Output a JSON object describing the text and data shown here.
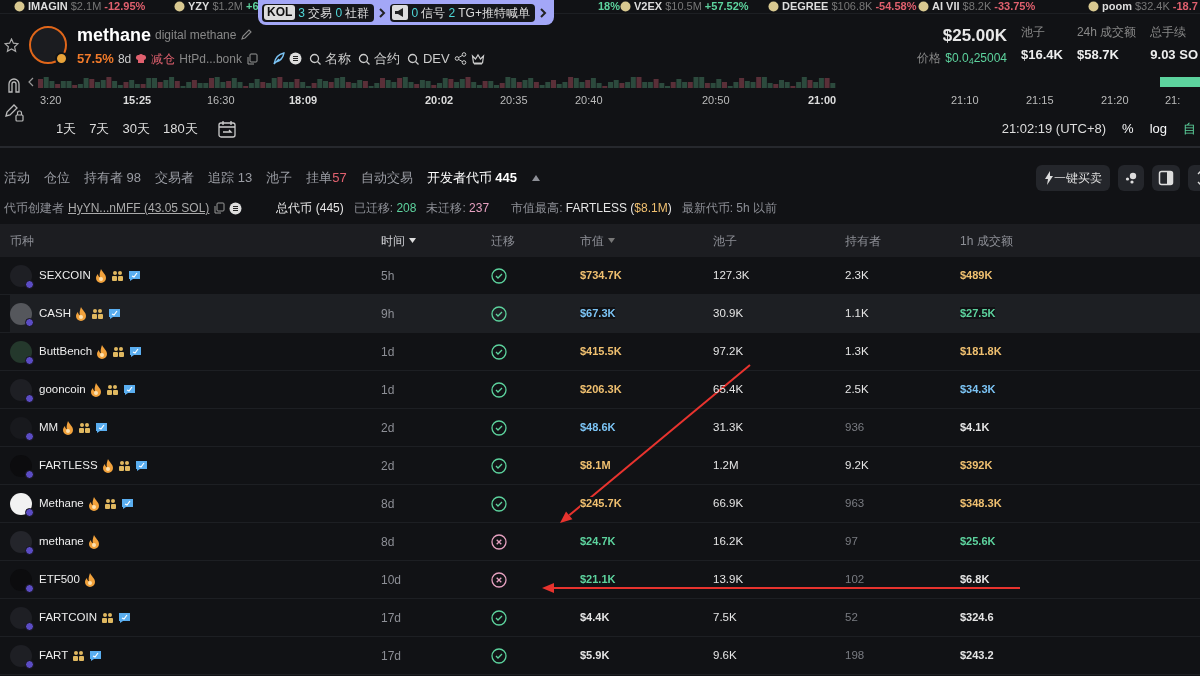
{
  "ticker": [
    {
      "name": "IMAGIN",
      "value": "$2.1M",
      "change": "-12.95%",
      "color": "#e0606e"
    },
    {
      "name": "YZY",
      "value": "$1.2M",
      "change": "+6",
      "color": "#5dd39e"
    },
    {
      "change": "18%",
      "color": "#5dd39e"
    },
    {
      "name": "V2EX",
      "value": "$10.5M",
      "change": "+57.52%",
      "color": "#5dd39e"
    },
    {
      "name": "DEGREE",
      "value": "$106.8K",
      "change": "-54.58%",
      "color": "#e0606e"
    },
    {
      "name": "AI VII",
      "value": "$8.2K",
      "change": "-33.75%",
      "color": "#e0606e"
    },
    {
      "name": "poom",
      "value": "$32.4K",
      "change": "-18.7",
      "color": "#e0606e"
    }
  ],
  "signal_popup": {
    "tag": "KOL",
    "groups": [
      [
        {
          "count": "3",
          "label": "交易"
        },
        {
          "count": "0",
          "label": "社群"
        }
      ],
      [
        {
          "count": "0",
          "label": "信号"
        },
        {
          "count": "2",
          "label": "TG+推特喊单"
        }
      ]
    ]
  },
  "token": {
    "symbol": "methane",
    "name": "digital methane",
    "change": "57.5%",
    "age": "8d",
    "dev_action": "减仓",
    "address": "HtPd...bonk",
    "searches": [
      "名称",
      "合约",
      "DEV"
    ],
    "market_cap": "$25.00K",
    "price_label": "价格",
    "price": "$0.0$_{4}$25004",
    "stats": [
      {
        "label": "池子",
        "value": "$16.4K"
      },
      {
        "label": "24h 成交额",
        "value": "$58.7K"
      },
      {
        "label": "总手续",
        "value": "9.03 SO"
      }
    ]
  },
  "chart": {
    "time_labels": [
      {
        "text": "3:20",
        "bold": false
      },
      {
        "text": "15:25",
        "bold": true
      },
      {
        "text": "16:30",
        "bold": false
      },
      {
        "text": "18:09",
        "bold": true
      },
      {
        "text": "20:02",
        "bold": true
      },
      {
        "text": "20:35",
        "bold": false
      },
      {
        "text": "20:40",
        "bold": false
      },
      {
        "text": "20:50",
        "bold": false
      },
      {
        "text": "21:00",
        "bold": true
      },
      {
        "text": "21:10",
        "bold": false
      },
      {
        "text": "21:15",
        "bold": false
      },
      {
        "text": "21:20",
        "bold": false
      },
      {
        "text": "21:",
        "bold": false
      }
    ],
    "ranges": [
      "1天",
      "7天",
      "30天",
      "180天"
    ],
    "clock": "21:02:19 (UTC+8)",
    "options": [
      "%",
      "log"
    ],
    "auto": "自"
  },
  "tabs": [
    {
      "label": "活动",
      "selected": false
    },
    {
      "label": "仓位",
      "selected": false
    },
    {
      "label": "持有者",
      "count": {
        "text": "98"
      },
      "selected": false
    },
    {
      "label": "交易者",
      "selected": false
    },
    {
      "label": "追踪",
      "count": {
        "text": "13"
      },
      "selected": false
    },
    {
      "label": "池子",
      "selected": false
    },
    {
      "label": "挂单",
      "count": {
        "text": "57",
        "color": "#e0606e"
      },
      "selected": false
    },
    {
      "label": "自动交易",
      "selected": false
    },
    {
      "label": "开发者代币",
      "count": {
        "text": "445"
      },
      "selected": true
    }
  ],
  "quick_trade": "一键买卖",
  "creator": {
    "label": "代币创建者",
    "address": "HyYN...nMFF (43.05 SOL)",
    "total": "总代币 (445)",
    "migrated_label": "已迁移:",
    "migrated": "208",
    "pending_label": "未迁移:",
    "pending": "237",
    "top_label": "市值最高:",
    "top_token": "FARTLESS (",
    "top_value": "$8.1M",
    "top_close": ")",
    "latest": "最新代币: 5h 以前"
  },
  "table": {
    "columns": [
      {
        "label": "币种",
        "sortable": false,
        "selected": false
      },
      {
        "label": "时间",
        "sortable": true,
        "selected": true
      },
      {
        "label": "迁移",
        "sortable": false,
        "selected": false
      },
      {
        "label": "市值",
        "sortable": true,
        "selected": false
      },
      {
        "label": "池子",
        "sortable": false,
        "selected": false
      },
      {
        "label": "持有者",
        "sortable": false,
        "selected": false
      },
      {
        "label": "1h 成交额",
        "sortable": false,
        "selected": false
      }
    ],
    "rows": [
      {
        "name": "SEXCOIN",
        "avatar": {
          "color": "#1e1f24"
        },
        "fire": true,
        "community": true,
        "chat": true,
        "time": "5h",
        "migrated": true,
        "market_cap": {
          "text": "$734.7K",
          "color": "#f0c070"
        },
        "pool": "127.3K",
        "holders": {
          "text": "2.3K",
          "color": "#e5e5e5"
        },
        "volume": {
          "text": "$489K",
          "color": "#f0c070"
        },
        "selected": false
      },
      {
        "name": "CASH",
        "avatar": {
          "color": "#55575c"
        },
        "fire": true,
        "community": true,
        "chat": true,
        "time": "9h",
        "migrated": true,
        "market_cap": {
          "text": "$67.3K",
          "color": "#7cc4f5"
        },
        "pool": "30.9K",
        "holders": {
          "text": "1.1K",
          "color": "#e5e5e5"
        },
        "volume": {
          "text": "$27.5K",
          "color": "#5dd39e"
        },
        "selected": true
      },
      {
        "name": "ButtBench",
        "avatar": {
          "color": "#24382c"
        },
        "fire": true,
        "community": true,
        "chat": true,
        "time": "1d",
        "migrated": true,
        "market_cap": {
          "text": "$415.5K",
          "color": "#f0c070"
        },
        "pool": "97.2K",
        "holders": {
          "text": "1.3K",
          "color": "#e5e5e5"
        },
        "volume": {
          "text": "$181.8K",
          "color": "#f0c070"
        },
        "selected": false
      },
      {
        "name": "gooncoin",
        "avatar": {
          "color": "#1e1f24"
        },
        "fire": true,
        "community": true,
        "chat": true,
        "time": "1d",
        "migrated": true,
        "market_cap": {
          "text": "$206.3K",
          "color": "#f0c070"
        },
        "pool": "65.4K",
        "holders": {
          "text": "2.5K",
          "color": "#e5e5e5"
        },
        "volume": {
          "text": "$34.3K",
          "color": "#7cc4f5"
        },
        "selected": false
      },
      {
        "name": "MM",
        "avatar": {
          "color": "#18191d"
        },
        "fire": true,
        "community": true,
        "chat": true,
        "time": "2d",
        "migrated": true,
        "market_cap": {
          "text": "$48.6K",
          "color": "#7cc4f5"
        },
        "pool": "31.3K",
        "holders": {
          "text": "936",
          "color": "#7a7c82"
        },
        "volume": {
          "text": "$4.1K",
          "color": "#e5e5e5"
        },
        "selected": false
      },
      {
        "name": "FARTLESS",
        "avatar": {
          "color": "#0c0c0e"
        },
        "fire": true,
        "community": true,
        "chat": true,
        "time": "2d",
        "migrated": true,
        "market_cap": {
          "text": "$8.1M",
          "color": "#f0c070"
        },
        "pool": "1.2M",
        "holders": {
          "text": "9.2K",
          "color": "#e5e5e5"
        },
        "volume": {
          "text": "$392K",
          "color": "#f0c070"
        },
        "selected": false
      },
      {
        "name": "Methane",
        "avatar": {
          "color": "#f2f2f2"
        },
        "fire": true,
        "community": true,
        "chat": true,
        "time": "8d",
        "migrated": true,
        "market_cap": {
          "text": "$245.7K",
          "color": "#f0c070"
        },
        "pool": "66.9K",
        "holders": {
          "text": "963",
          "color": "#7a7c82"
        },
        "volume": {
          "text": "$348.3K",
          "color": "#f0c070"
        },
        "selected": false
      },
      {
        "name": "methane",
        "avatar": {
          "color": "#24252b"
        },
        "fire": true,
        "community": false,
        "chat": false,
        "time": "8d",
        "migrated": false,
        "market_cap": {
          "text": "$24.7K",
          "color": "#5dd39e"
        },
        "pool": "16.2K",
        "holders": {
          "text": "97",
          "color": "#7a7c82"
        },
        "volume": {
          "text": "$25.6K",
          "color": "#5dd39e"
        },
        "selected": false
      },
      {
        "name": "ETF500",
        "avatar": {
          "color": "#0c0c0e"
        },
        "fire": true,
        "community": false,
        "chat": false,
        "time": "10d",
        "migrated": false,
        "market_cap": {
          "text": "$21.1K",
          "color": "#5dd39e"
        },
        "pool": "13.9K",
        "holders": {
          "text": "102",
          "color": "#7a7c82"
        },
        "volume": {
          "text": "$6.8K",
          "color": "#e5e5e5"
        },
        "selected": false
      },
      {
        "name": "FARTCOIN",
        "avatar": {
          "color": "#1e1f24"
        },
        "fire": false,
        "community": true,
        "chat": true,
        "time": "17d",
        "migrated": true,
        "market_cap": {
          "text": "$4.4K",
          "color": "#e5e5e5"
        },
        "pool": "7.5K",
        "holders": {
          "text": "52",
          "color": "#7a7c82"
        },
        "volume": {
          "text": "$324.6",
          "color": "#e5e5e5"
        },
        "selected": false
      },
      {
        "name": "FART",
        "avatar": {
          "color": "#1e1f24"
        },
        "fire": false,
        "community": true,
        "chat": true,
        "time": "17d",
        "migrated": true,
        "market_cap": {
          "text": "$5.9K",
          "color": "#e5e5e5"
        },
        "pool": "9.6K",
        "holders": {
          "text": "198",
          "color": "#7a7c82"
        },
        "volume": {
          "text": "$243.2",
          "color": "#e5e5e5"
        },
        "selected": false
      }
    ]
  },
  "annotation_arrows": [
    {
      "kind": "arrow"
    },
    {
      "kind": "arrow"
    }
  ]
}
